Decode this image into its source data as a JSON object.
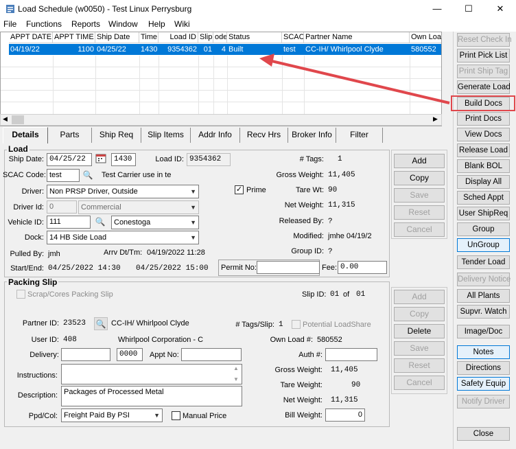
{
  "window": {
    "title": "Load Schedule (w0050) - Test Linux Perrysburg",
    "minimize": "—",
    "maximize": "☐",
    "close": "✕"
  },
  "menu": [
    "File",
    "Functions",
    "Reports",
    "Window",
    "Help",
    "Wiki"
  ],
  "grid": {
    "columns": [
      "APPT DATE",
      "APPT TIME",
      "Ship Date",
      "Time",
      "Load ID",
      "Slip",
      "ode",
      "Status",
      "SCAC",
      "Partner Name",
      "Own Loa"
    ],
    "rows": [
      [
        "04/19/22",
        "1100",
        "04/25/22",
        "1430",
        "9354362",
        "01",
        "4",
        "Built",
        "test",
        "CC-IH/ Whirlpool Clyde",
        "580552"
      ]
    ]
  },
  "tabs": [
    "Details",
    "Parts",
    "Ship Req",
    "Slip Items",
    "Addr Info",
    "Recv Hrs",
    "Broker Info",
    "Filter"
  ],
  "load": {
    "title": "Load",
    "ship_date_label": "Ship Date:",
    "ship_date": "04/25/22",
    "ship_time": "1430",
    "load_id_label": "Load ID:",
    "load_id": "9354362",
    "tags_label": "# Tags:",
    "tags": "1",
    "scac_label": "SCAC Code:",
    "scac": "test",
    "scac_desc": "Test Carrier use in te",
    "gross_label": "Gross Weight:",
    "gross": "11,405",
    "driver_label": "Driver:",
    "driver": "Non PRSP Driver, Outside",
    "prime_label": "Prime",
    "tare_label": "Tare Wt:",
    "tare": "90",
    "driver_id_label": "Driver Id:",
    "driver_id": "0",
    "driver_type": "Commercial",
    "net_label": "Net Weight:",
    "net": "11,315",
    "vehicle_label": "Vehicle ID:",
    "vehicle": "111",
    "vehicle_type": "Conestoga",
    "released_label": "Released By:",
    "released": "?",
    "dock_label": "Dock:",
    "dock": "14 HB Side Load",
    "modified_label": "Modified:",
    "modified": "jmhe 04/19/2",
    "pulled_label": "Pulled By:",
    "pulled": "jmh",
    "arrv_label": "Arrv Dt/Tm:",
    "arrv": "04/19/2022 11:28",
    "group_label": "Group ID:",
    "group": "?",
    "startend_label": "Start/End:",
    "start": "04/25/2022 14:30",
    "end": "04/25/2022 15:00",
    "permit_label": "Permit No:",
    "permit": "",
    "fee_label": "Fee:",
    "fee": "0.00",
    "buttons": [
      "Add",
      "Copy",
      "Save",
      "Reset",
      "Cancel"
    ]
  },
  "slip": {
    "title": "Packing Slip",
    "scrap_label": "Scrap/Cores Packing Slip",
    "slip_id_label": "Slip ID:",
    "slip_id": "01",
    "of_label": "of",
    "slip_total": "01",
    "partner_label": "Partner ID:",
    "partner_id": "23523",
    "partner_name": "CC-IH/ Whirlpool Clyde",
    "tags_label": "# Tags/Slip:",
    "tags": "1",
    "potential_label": "Potential LoadShare",
    "user_label": "User ID:",
    "user_id": "408",
    "user_name": "Whirlpool Corporation - C",
    "own_label": "Own Load #:",
    "own": "580552",
    "delivery_label": "Delivery:",
    "delivery": "",
    "delivery_time": "0000",
    "appt_label": "Appt No:",
    "appt": "",
    "auth_label": "Auth #:",
    "auth": "",
    "instructions_label": "Instructions:",
    "instructions": "",
    "gross_label": "Gross Weight:",
    "gross": "11,405",
    "tare_label": "Tare Weight:",
    "tare": "90",
    "description_label": "Description:",
    "description": "Packages of Processed Metal",
    "net_label": "Net Weight:",
    "net": "11,315",
    "ppd_label": "Ppd/Col:",
    "ppd": "Freight Paid By PSI",
    "manual_label": "Manual Price",
    "bill_label": "Bill Weight:",
    "bill": "0",
    "buttons": [
      "Add",
      "Copy",
      "Delete",
      "Save",
      "Reset",
      "Cancel"
    ]
  },
  "sidebar": [
    "Reset Check In",
    "Print Pick List",
    "Print Ship Tag",
    "Generate Load",
    "Build Docs",
    "Print Docs",
    "View Docs",
    "Release Load",
    "Blank BOL",
    "Display All",
    "Sched Appt",
    "User ShipReq",
    "Group",
    "UnGroup",
    "Tender Load",
    "Delivery Notice",
    "All Plants",
    "Supvr. Watch",
    "Image/Doc",
    "Notes",
    "Directions",
    "Safety Equip",
    "Notify Driver",
    "Close"
  ],
  "colors": {
    "selection": "#0078d7",
    "annotation": "#e0474c"
  }
}
